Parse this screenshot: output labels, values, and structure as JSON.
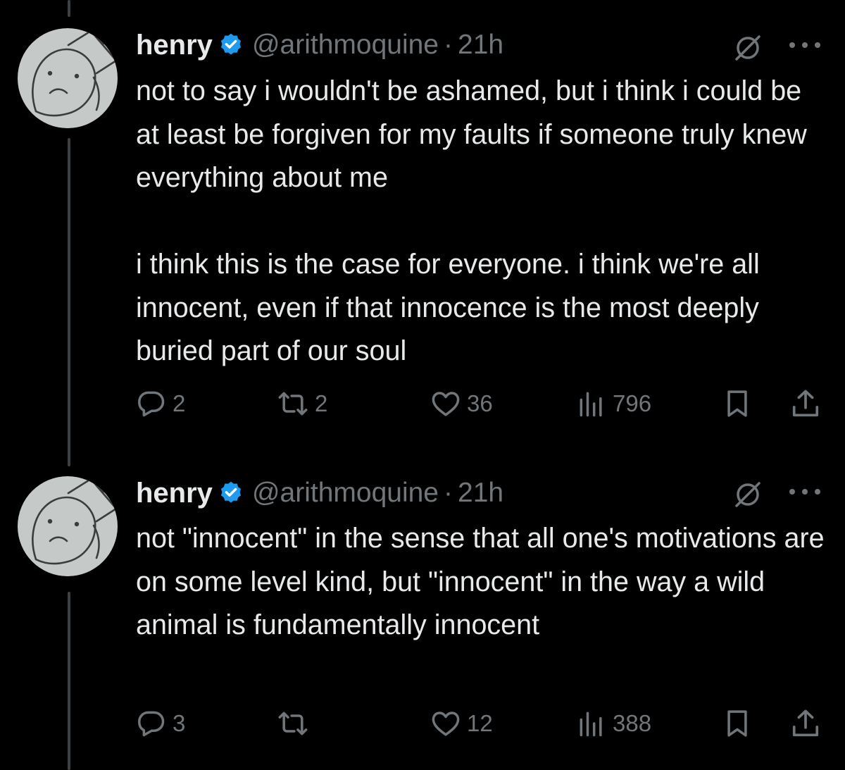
{
  "tweets": [
    {
      "author_name": "henry",
      "handle": "@arithmoquine",
      "separator": "·",
      "time": "21h",
      "paragraphs": [
        "not to say i wouldn't be ashamed, but i think i could be at least be forgiven for my faults if someone truly knew everything about me",
        "i think this is the case for everyone. i think we're all innocent, even if that innocence is the most deeply buried part of our soul"
      ],
      "replies": "2",
      "reposts": "2",
      "likes": "36",
      "views": "796"
    },
    {
      "author_name": "henry",
      "handle": "@arithmoquine",
      "separator": "·",
      "time": "21h",
      "paragraphs": [
        "not \"innocent\" in the sense that all one's motivations are on some level kind, but \"innocent\" in the way a wild animal is fundamentally innocent"
      ],
      "replies": "3",
      "reposts": "",
      "likes": "12",
      "views": "388"
    }
  ],
  "icons": {
    "avatar": "avatar-drawing",
    "verified": "verified-badge-icon",
    "grok": "grok-icon",
    "more": "more-icon",
    "reply": "reply-icon",
    "repost": "repost-icon",
    "like": "heart-icon",
    "views": "views-icon",
    "bookmark": "bookmark-icon",
    "share": "share-icon"
  },
  "colors": {
    "background": "#000000",
    "text": "#e7e9ea",
    "secondary": "#71767b",
    "verified": "#1d9bf0",
    "thread_line": "#3e4144"
  }
}
